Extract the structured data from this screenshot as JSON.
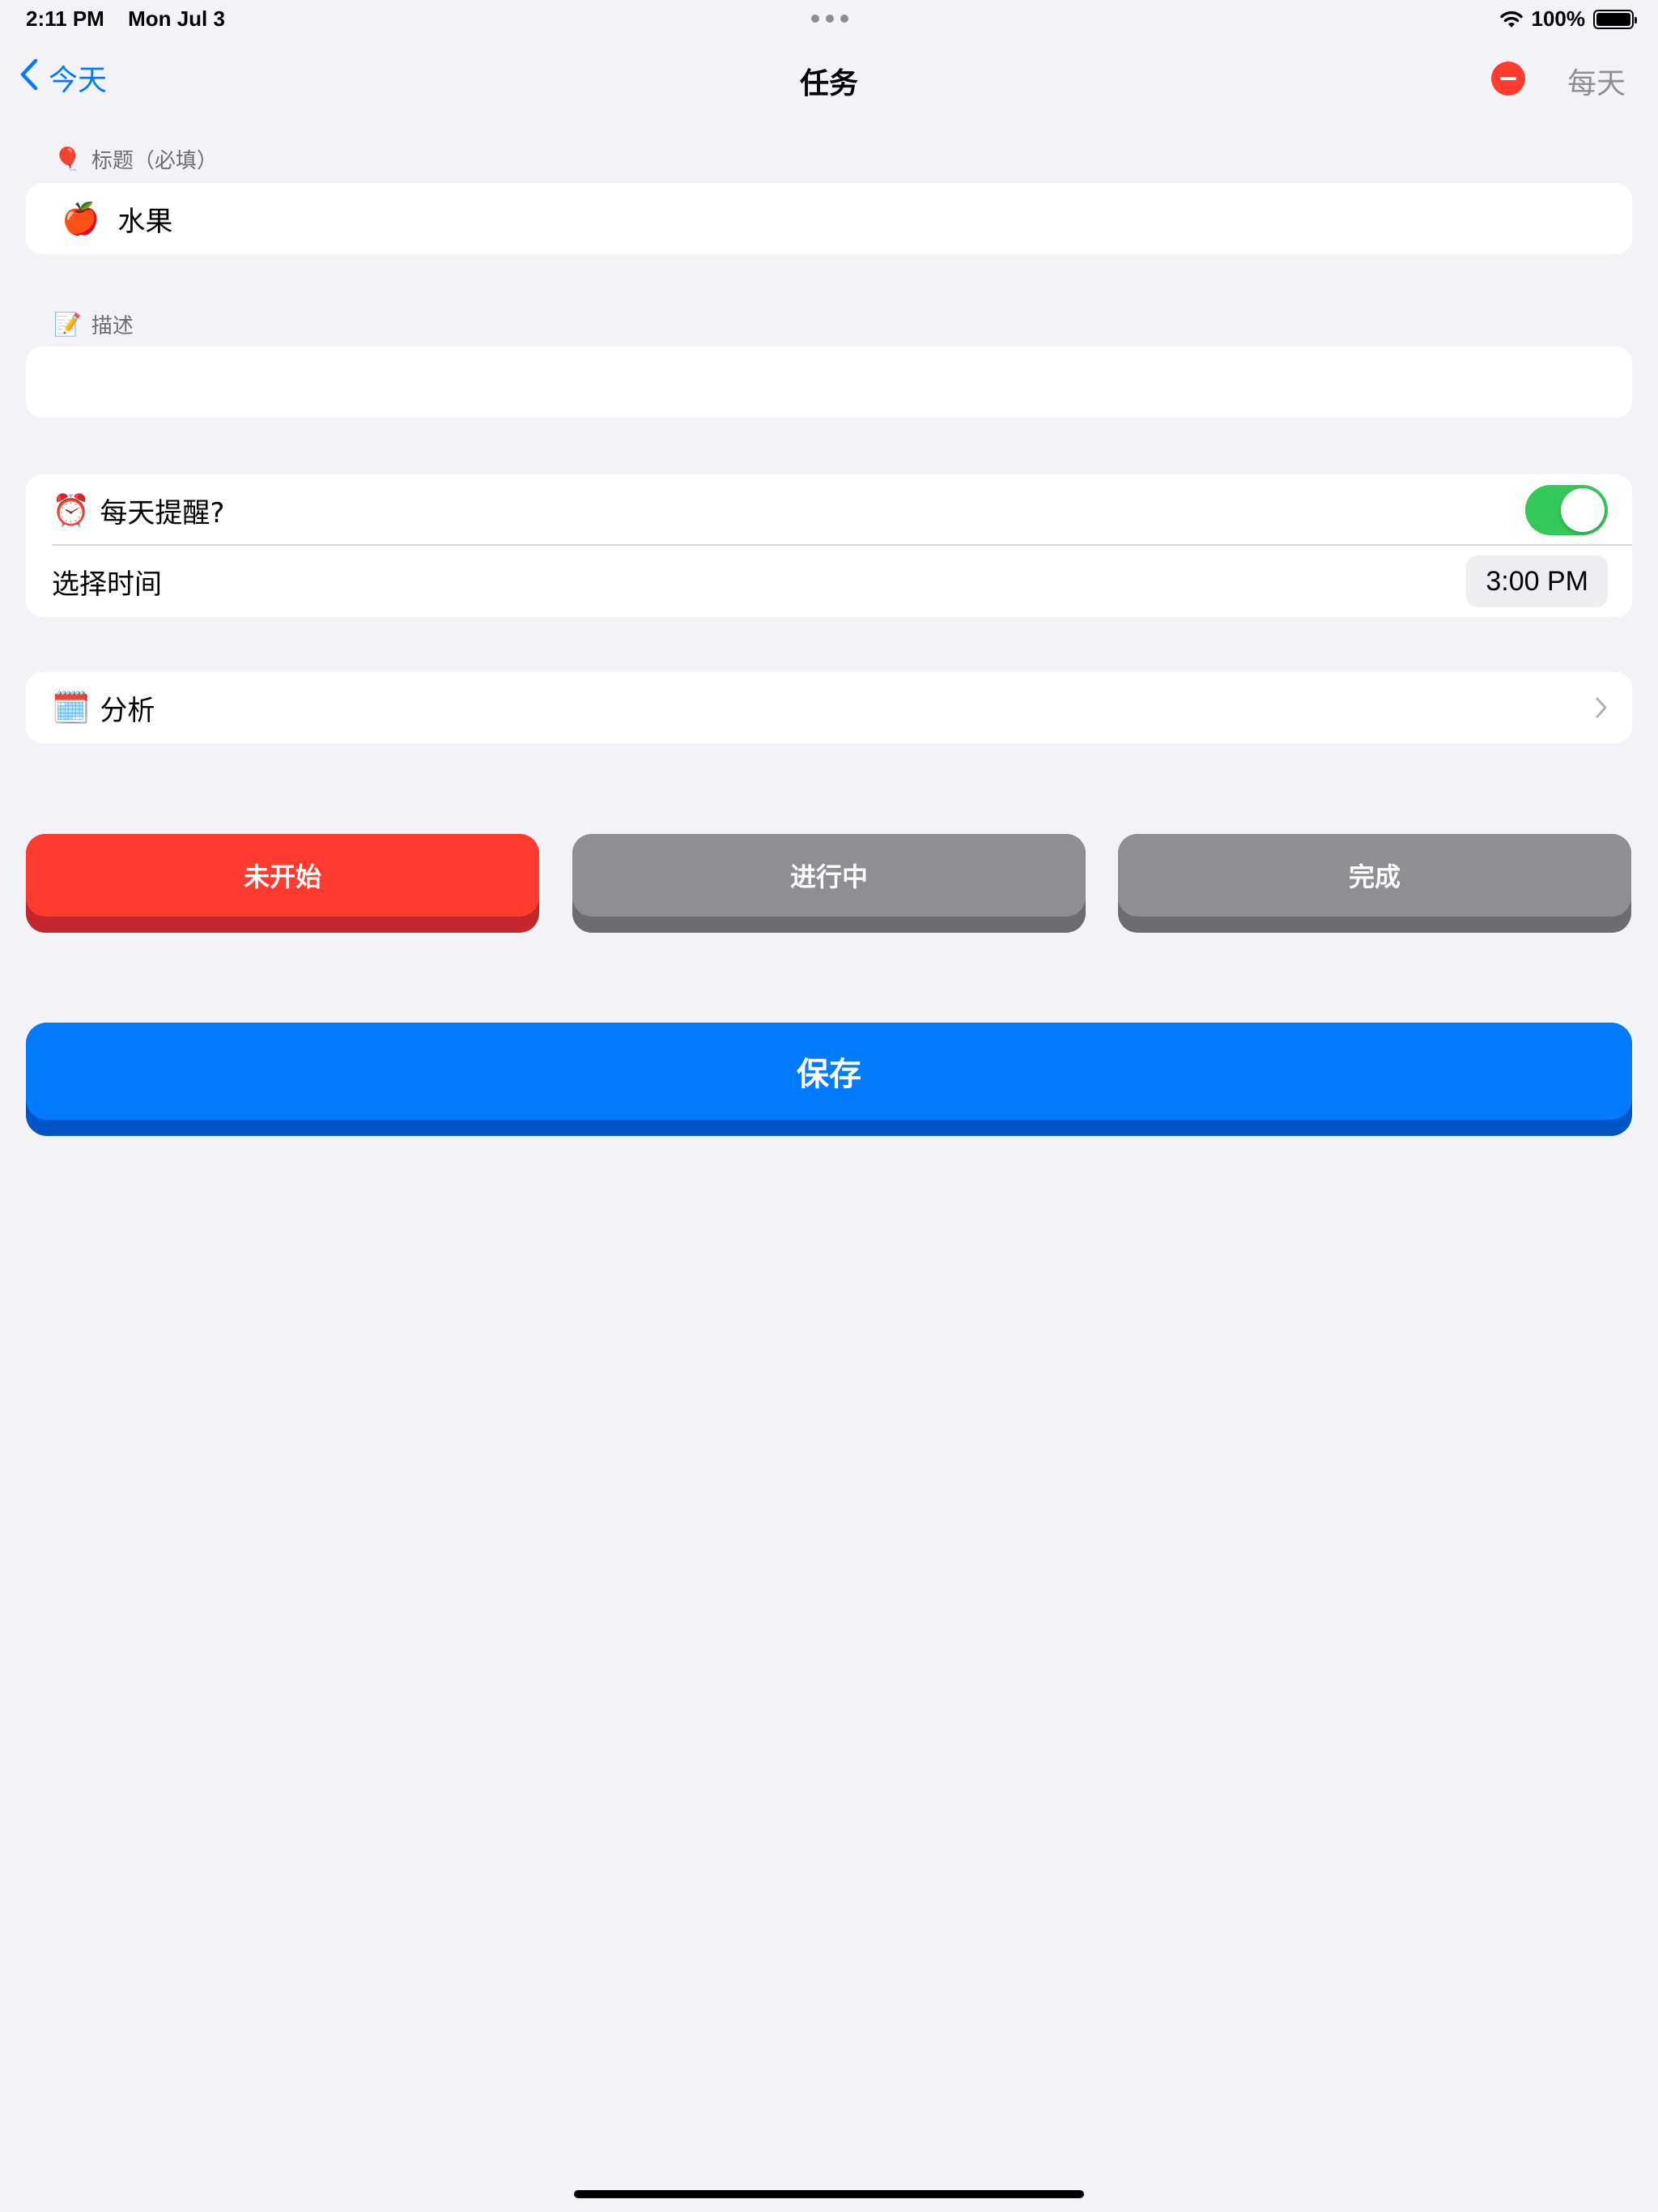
{
  "status_bar": {
    "time": "2:11 PM",
    "date": "Mon Jul 3",
    "battery": "100%"
  },
  "nav": {
    "back_label": "今天",
    "title": "任务",
    "right_label": "每天"
  },
  "title_section": {
    "header_icon": "🎈",
    "header": "标题（必填）",
    "value_icon": "🍎",
    "value": "水果"
  },
  "description_section": {
    "header_icon": "📝",
    "header": "描述",
    "value": ""
  },
  "reminder": {
    "icon": "⏰",
    "label": "每天提醒?",
    "enabled": true,
    "time_label": "选择时间",
    "time_value": "3:00 PM"
  },
  "analysis": {
    "icon": "🗓️",
    "label": "分析"
  },
  "status_buttons": [
    {
      "label": "未开始",
      "selected": true
    },
    {
      "label": "进行中",
      "selected": false
    },
    {
      "label": "完成",
      "selected": false
    }
  ],
  "save_label": "保存",
  "colors": {
    "accent": "#007aff",
    "destructive": "#ff3b30",
    "toggle_on": "#34c759",
    "inactive": "#8e8e93",
    "background": "#f2f2f7"
  }
}
